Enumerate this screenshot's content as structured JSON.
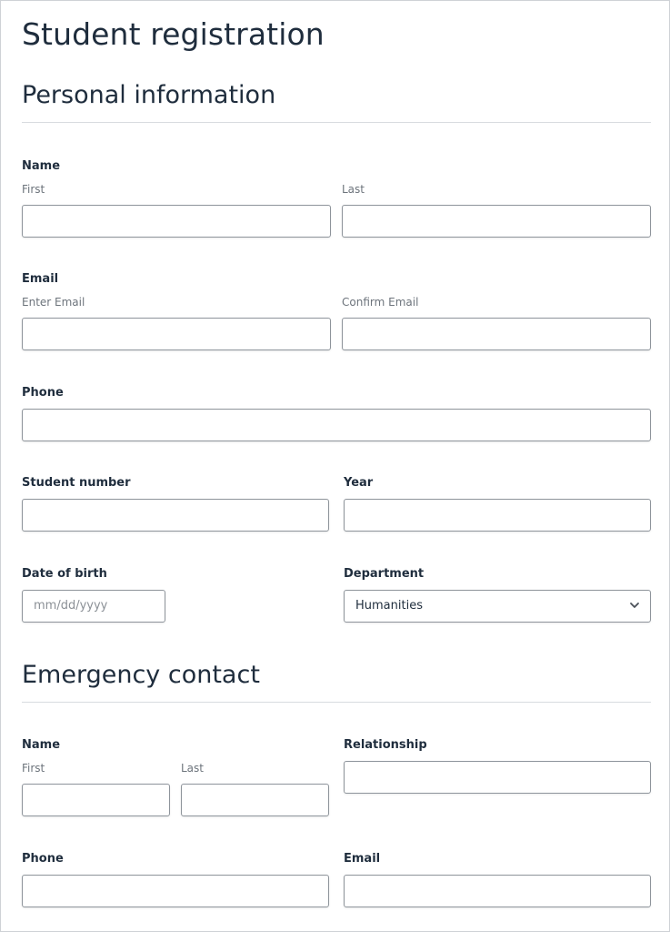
{
  "page": {
    "title": "Student registration"
  },
  "personal": {
    "heading": "Personal information",
    "name": {
      "label": "Name",
      "first_label": "First",
      "last_label": "Last",
      "first_value": "",
      "last_value": ""
    },
    "email": {
      "label": "Email",
      "enter_label": "Enter Email",
      "confirm_label": "Confirm Email",
      "enter_value": "",
      "confirm_value": ""
    },
    "phone": {
      "label": "Phone",
      "value": ""
    },
    "student_number": {
      "label": "Student number",
      "value": ""
    },
    "year": {
      "label": "Year",
      "value": ""
    },
    "dob": {
      "label": "Date of birth",
      "placeholder": "mm/dd/yyyy"
    },
    "department": {
      "label": "Department",
      "selected": "Humanities",
      "icon": "chevron-down-icon"
    }
  },
  "emergency": {
    "heading": "Emergency contact",
    "name": {
      "label": "Name",
      "first_label": "First",
      "last_label": "Last",
      "first_value": "",
      "last_value": ""
    },
    "relationship": {
      "label": "Relationship",
      "value": ""
    },
    "phone": {
      "label": "Phone",
      "value": ""
    },
    "email": {
      "label": "Email",
      "value": ""
    }
  }
}
